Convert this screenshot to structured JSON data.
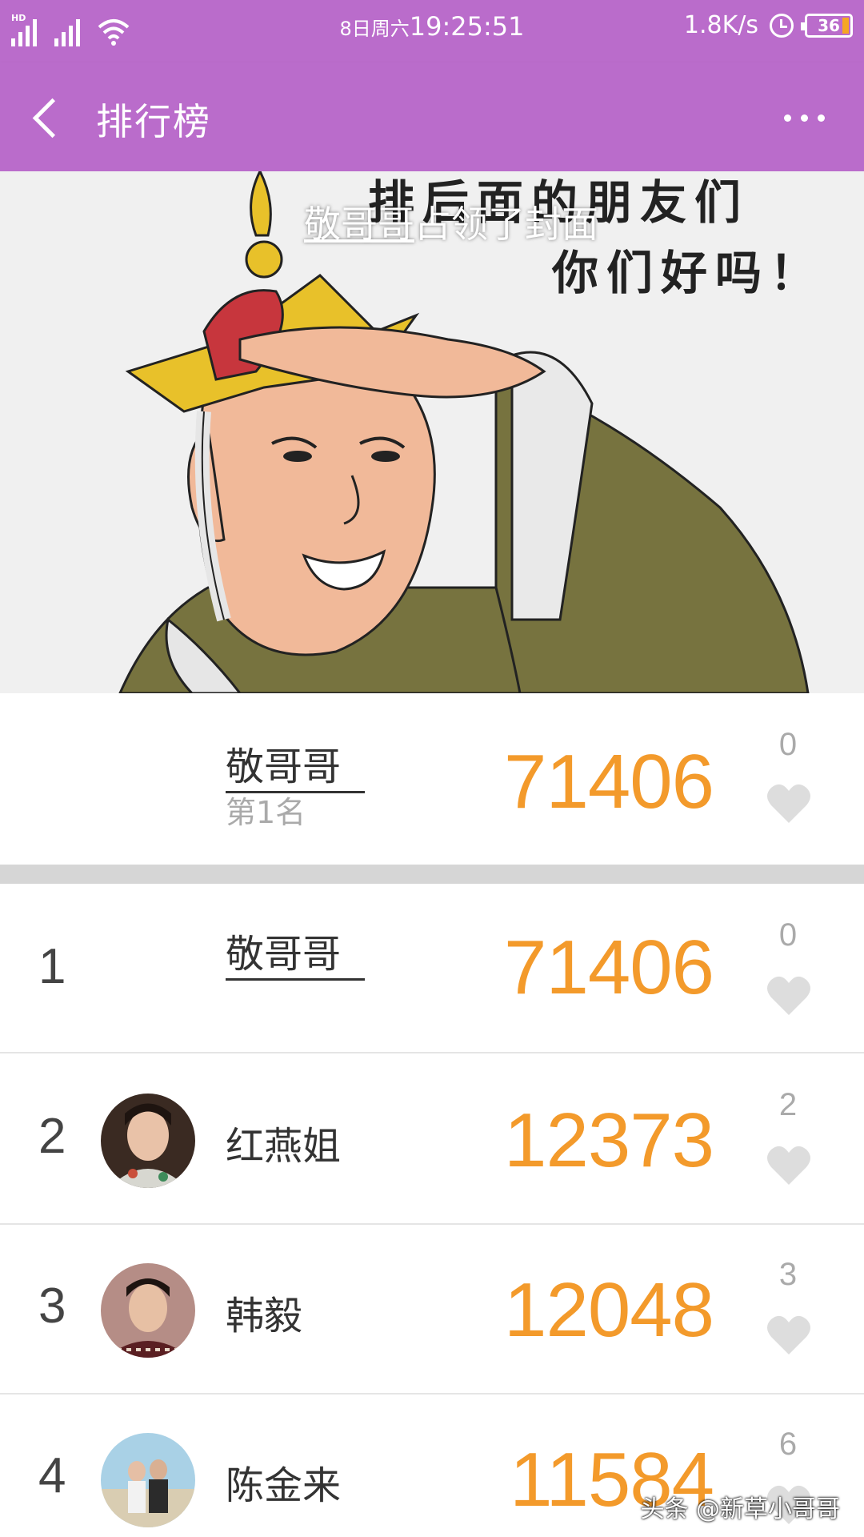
{
  "status_bar": {
    "hd_label": "HD",
    "date": "8日周六",
    "time": "19:25:51",
    "net_speed": "1.8K/s",
    "battery": "36"
  },
  "app_bar": {
    "title": "排行榜"
  },
  "cover": {
    "caption_name": "敬哥哥",
    "caption_rest": "占领了封面",
    "handwriting_line1": "排后面的朋友们",
    "handwriting_line2": "你们好吗！"
  },
  "top_entry": {
    "name": "敬哥哥",
    "rank_label": "第1名",
    "score": "71406",
    "likes": "0"
  },
  "ranking": [
    {
      "rank": "1",
      "name": "敬哥哥",
      "score": "71406",
      "likes": "0"
    },
    {
      "rank": "2",
      "name": "红燕姐",
      "score": "12373",
      "likes": "2"
    },
    {
      "rank": "3",
      "name": "韩毅",
      "score": "12048",
      "likes": "3"
    },
    {
      "rank": "4",
      "name": "陈金来",
      "score": "11584",
      "likes": "6"
    }
  ],
  "watermark": "头条 @新草小哥哥",
  "colors": {
    "header": "#ba6ccb",
    "score": "#f39a2b",
    "heart": "#dddddd"
  }
}
